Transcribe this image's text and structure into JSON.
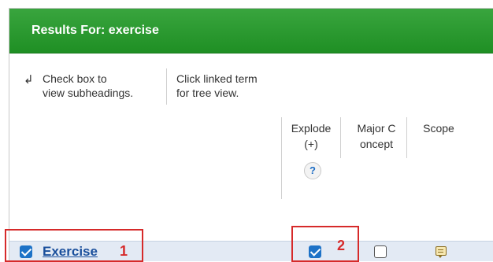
{
  "header": {
    "title": "Results For: exercise"
  },
  "instructions": {
    "checkbox_line1": "Check box to",
    "checkbox_line2": "view subheadings.",
    "link_line1": "Click linked term",
    "link_line2": "for tree view."
  },
  "columns": {
    "explode_line1": "Explode",
    "explode_line2": "(+)",
    "major_line1": "Major C",
    "major_line2": "oncept",
    "scope": "Scope",
    "help": "?"
  },
  "rows": [
    {
      "term": "Exercise",
      "selected": true,
      "explode": true,
      "major_concept": false
    }
  ],
  "annotations": {
    "first": "1",
    "second": "2"
  },
  "colors": {
    "header": "#2a9a30",
    "highlight": "#d62a2a",
    "row": "#e3eaf4",
    "link": "#1a4f9c"
  }
}
